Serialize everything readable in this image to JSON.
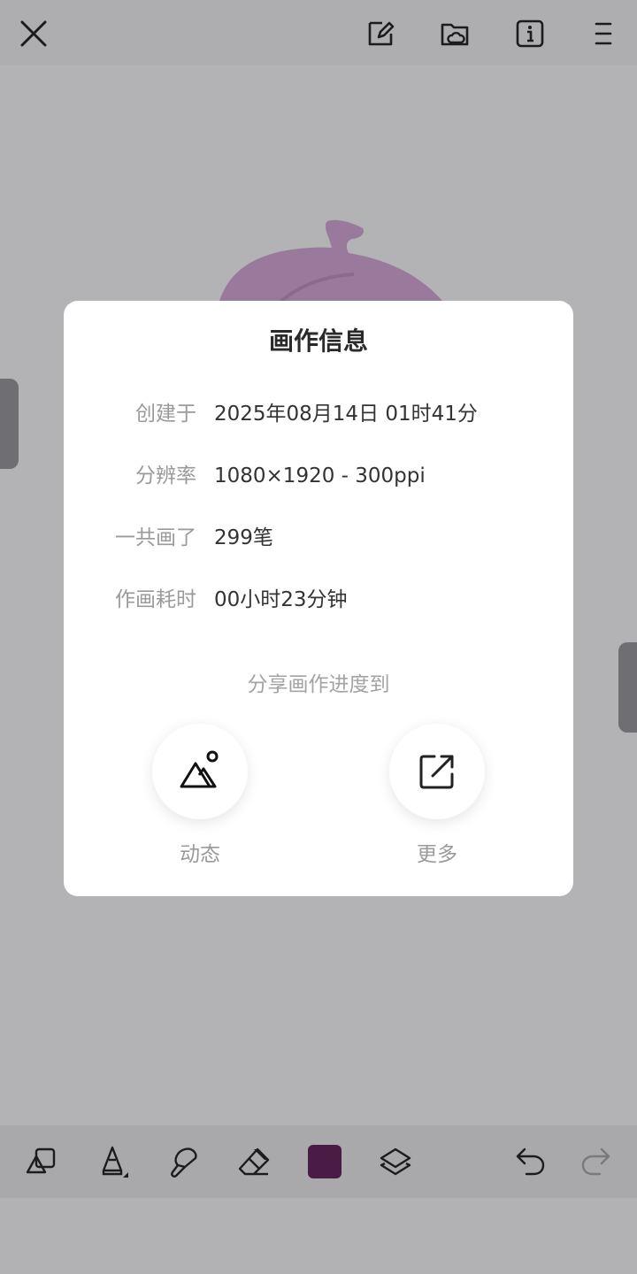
{
  "dialog": {
    "title": "画作信息",
    "rows": [
      {
        "label": "创建于",
        "value": "2025年08月14日 01时41分"
      },
      {
        "label": "分辨率",
        "value": "1080×1920 - 300ppi"
      },
      {
        "label": "一共画了",
        "value": "299笔"
      },
      {
        "label": "作画耗时",
        "value": "00小时23分钟"
      }
    ],
    "share_title": "分享画作进度到",
    "share_options": [
      {
        "label": "动态",
        "icon": "mountain-sun-icon"
      },
      {
        "label": "更多",
        "icon": "external-share-icon"
      }
    ]
  },
  "toolbar": {
    "top_icons": [
      "close-icon",
      "edit-canvas-icon",
      "cloud-folder-icon",
      "info-icon",
      "menu-icon"
    ],
    "bottom_icons": [
      "shapes-icon",
      "pencil-icon",
      "smudge-icon",
      "eraser-icon",
      "color-swatch",
      "layers-icon",
      "undo-icon",
      "redo-icon"
    ],
    "current_color": "#4a1c45"
  },
  "colors": {
    "overlay": "#b2b1b4",
    "dialog_bg": "#ffffff",
    "artwork": "#9a7a9c"
  }
}
